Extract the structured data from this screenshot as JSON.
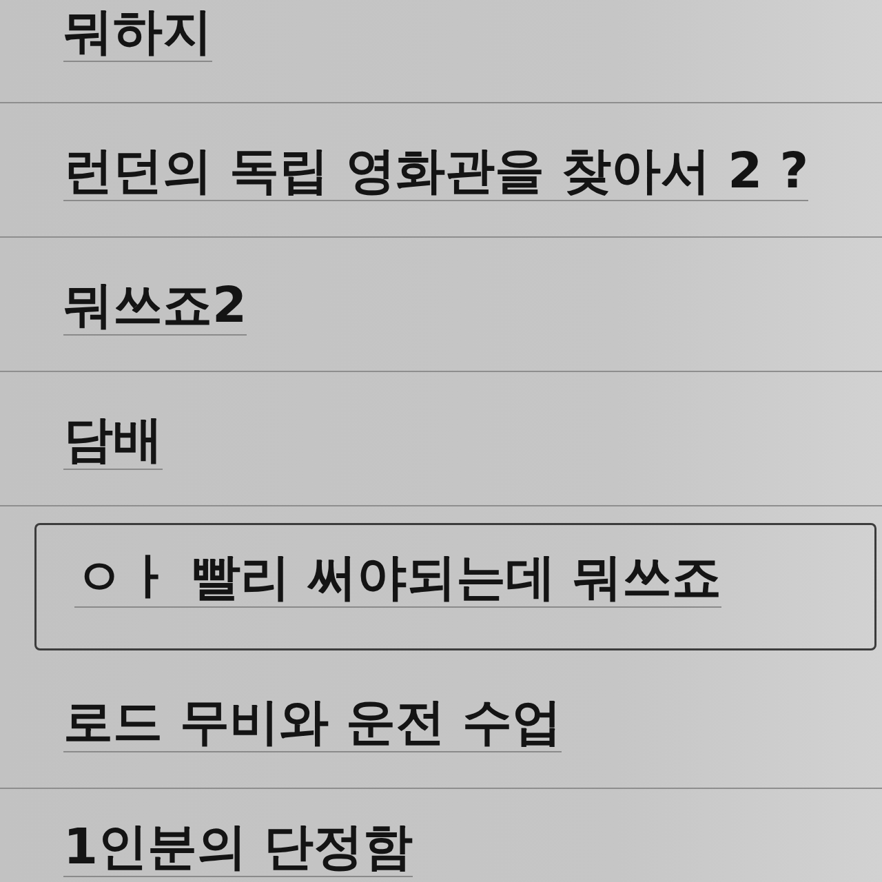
{
  "items": [
    {
      "kind": "title",
      "text": "뭐하지"
    },
    {
      "kind": "title",
      "text": "런던의 독립 영화관을 찾아서 2 ?"
    },
    {
      "kind": "title",
      "text": "뭐쓰죠2"
    },
    {
      "kind": "title",
      "text": "담배"
    },
    {
      "kind": "field",
      "value": "ㅇㅏ 빨리 써야되는데 뭐쓰죠"
    },
    {
      "kind": "title",
      "text": "로드 무비와 운전 수업"
    },
    {
      "kind": "title",
      "text": "1인분의 단정함"
    }
  ]
}
